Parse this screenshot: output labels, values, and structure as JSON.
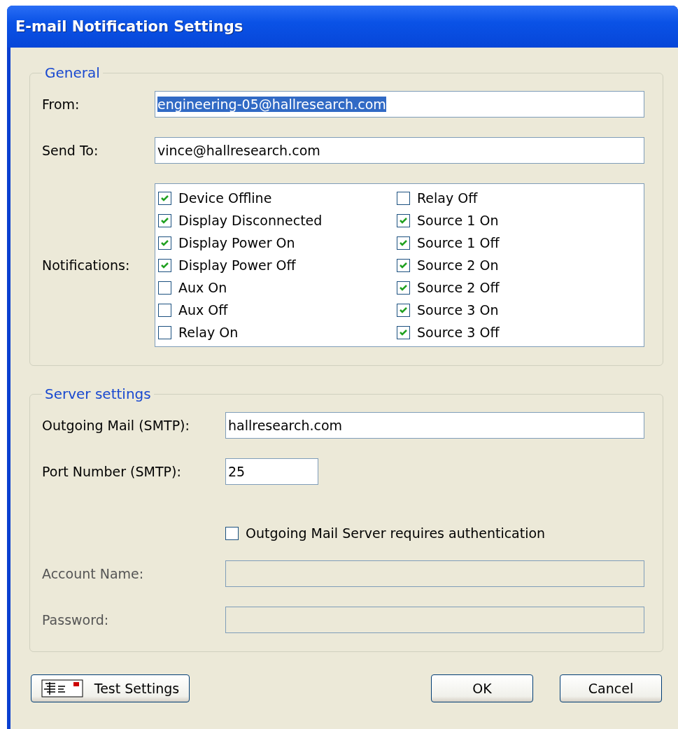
{
  "window": {
    "title": "E-mail Notification Settings"
  },
  "general": {
    "title": "General",
    "fields": [
      {
        "label": "From:",
        "value": "engineering-05@hallresearch.com",
        "selected": true
      },
      {
        "label": "Send To:",
        "value": "vince@hallresearch.com",
        "selected": false
      }
    ],
    "notifications": {
      "label": "Notifications:",
      "items": [
        {
          "label": "Device Offline",
          "checked": true
        },
        {
          "label": "Display Disconnected",
          "checked": true
        },
        {
          "label": "Display Power On",
          "checked": true
        },
        {
          "label": "Display Power Off",
          "checked": true
        },
        {
          "label": "Aux On",
          "checked": false
        },
        {
          "label": "Aux Off",
          "checked": false
        },
        {
          "label": "Relay On",
          "checked": false
        },
        {
          "label": "Relay Off",
          "checked": false
        },
        {
          "label": "Source 1 On",
          "checked": true
        },
        {
          "label": "Source 1 Off",
          "checked": true
        },
        {
          "label": "Source 2 On",
          "checked": true
        },
        {
          "label": "Source 2 Off",
          "checked": true
        },
        {
          "label": "Source 3 On",
          "checked": true
        },
        {
          "label": "Source 3 Off",
          "checked": true
        }
      ]
    }
  },
  "server": {
    "title": "Server settings",
    "smtp": {
      "label": "Outgoing Mail (SMTP):",
      "value": "hallresearch.com"
    },
    "port": {
      "label": "Port Number (SMTP):",
      "value": "25"
    },
    "auth": {
      "label": "Outgoing Mail Server requires authentication",
      "checked": false
    },
    "account": [
      {
        "label": "Account Name:",
        "disabled": true
      },
      {
        "label": "Password:",
        "disabled": true
      }
    ]
  },
  "buttons": {
    "test": "Test Settings",
    "ok": "OK",
    "cancel": "Cancel"
  }
}
